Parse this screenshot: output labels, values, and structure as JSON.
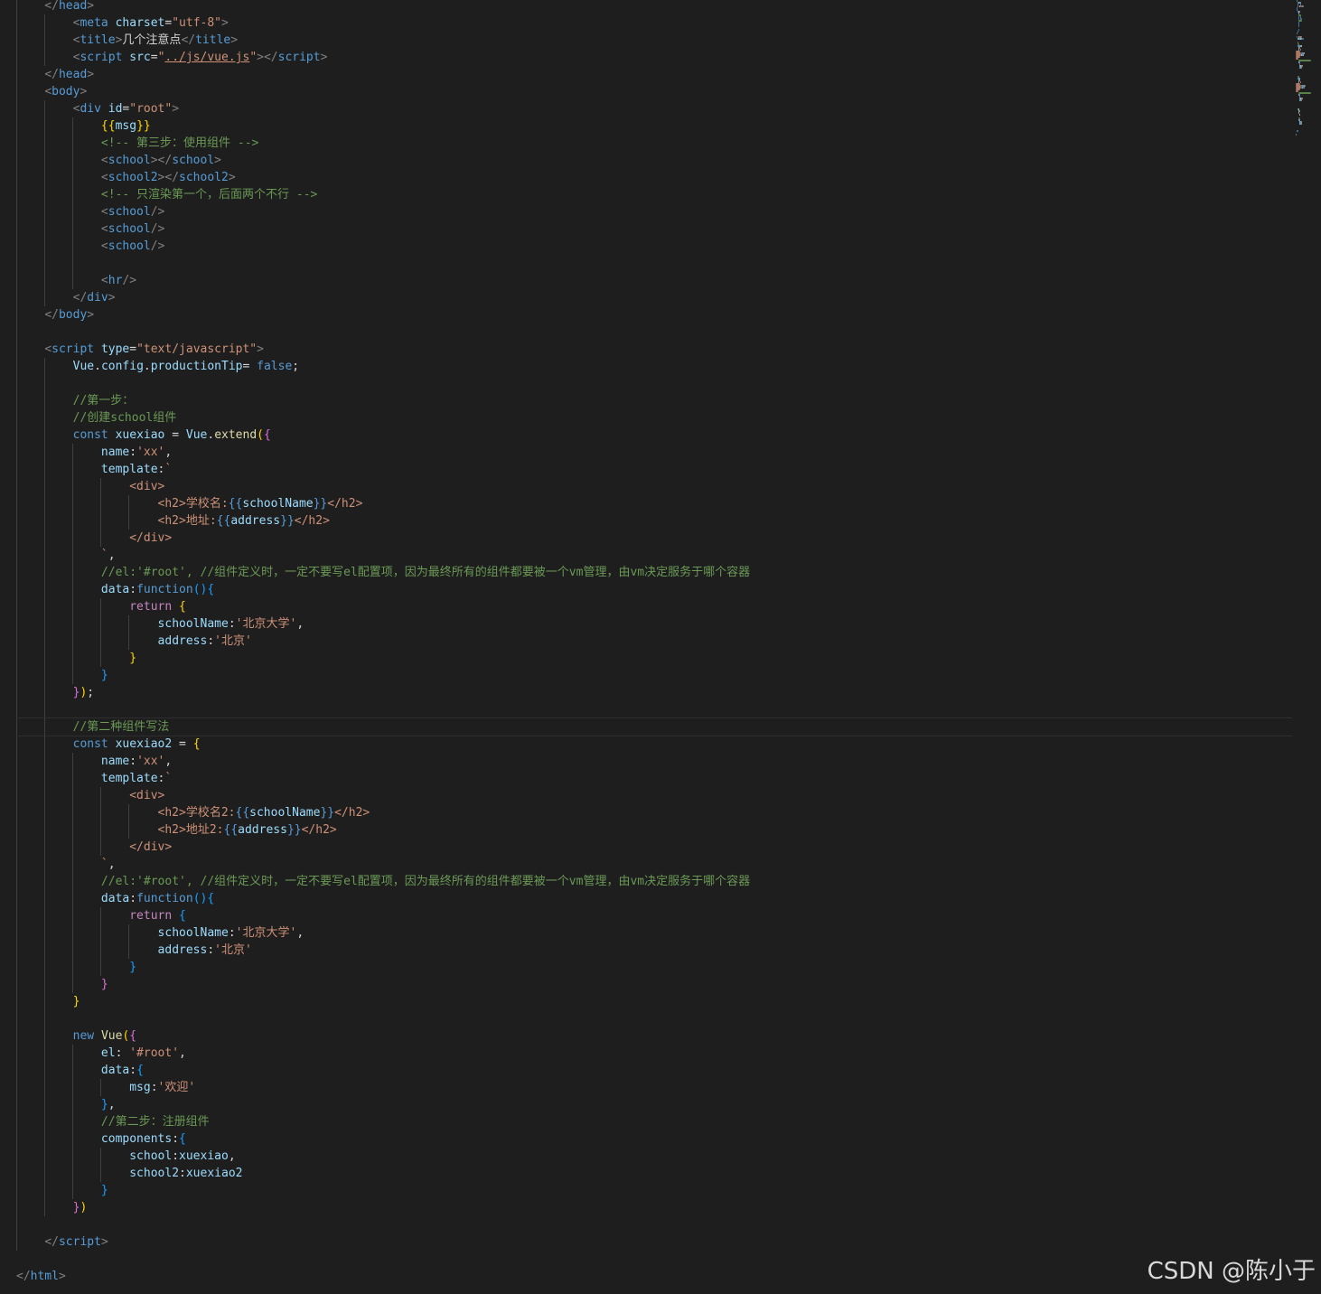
{
  "editor": {
    "lines": [
      [
        [
          "t-br",
          "    </"
        ],
        [
          "t-tag",
          "head"
        ],
        [
          "t-br",
          ">"
        ]
      ],
      [
        [
          "t-txt",
          "        "
        ],
        [
          "t-br",
          "<"
        ],
        [
          "t-tag",
          "meta"
        ],
        [
          "t-txt",
          " "
        ],
        [
          "t-attr",
          "charset"
        ],
        [
          "t-txt",
          "="
        ],
        [
          "t-str",
          "\"utf-8\""
        ],
        [
          "t-br",
          ">"
        ]
      ],
      [
        [
          "t-txt",
          "        "
        ],
        [
          "t-br",
          "<"
        ],
        [
          "t-tag",
          "title"
        ],
        [
          "t-br",
          ">"
        ],
        [
          "t-txt",
          "几个注意点"
        ],
        [
          "t-br",
          "</"
        ],
        [
          "t-tag",
          "title"
        ],
        [
          "t-br",
          ">"
        ]
      ],
      [
        [
          "t-txt",
          "        "
        ],
        [
          "t-br",
          "<"
        ],
        [
          "t-tag",
          "script"
        ],
        [
          "t-txt",
          " "
        ],
        [
          "t-attr",
          "src"
        ],
        [
          "t-txt",
          "="
        ],
        [
          "t-str",
          "\""
        ],
        [
          "t-link",
          "../js/vue.js"
        ],
        [
          "t-str",
          "\""
        ],
        [
          "t-br",
          "></"
        ],
        [
          "t-tag",
          "script"
        ],
        [
          "t-br",
          ">"
        ]
      ],
      [
        [
          "t-txt",
          "    "
        ],
        [
          "t-br",
          "</"
        ],
        [
          "t-tag",
          "head"
        ],
        [
          "t-br",
          ">"
        ]
      ],
      [
        [
          "t-txt",
          "    "
        ],
        [
          "t-br",
          "<"
        ],
        [
          "t-tag",
          "body"
        ],
        [
          "t-br",
          ">"
        ]
      ],
      [
        [
          "t-txt",
          "        "
        ],
        [
          "t-br",
          "<"
        ],
        [
          "t-tag",
          "div"
        ],
        [
          "t-txt",
          " "
        ],
        [
          "t-attr",
          "id"
        ],
        [
          "t-txt",
          "="
        ],
        [
          "t-str",
          "\"root\""
        ],
        [
          "t-br",
          ">"
        ]
      ],
      [
        [
          "t-txt",
          "            "
        ],
        [
          "t-p1",
          "{{"
        ],
        [
          "t-var",
          "msg"
        ],
        [
          "t-p1",
          "}}"
        ]
      ],
      [
        [
          "t-txt",
          "            "
        ],
        [
          "t-com",
          "<!-- 第三步：使用组件 -->"
        ]
      ],
      [
        [
          "t-txt",
          "            "
        ],
        [
          "t-br",
          "<"
        ],
        [
          "t-tag",
          "school"
        ],
        [
          "t-br",
          "></"
        ],
        [
          "t-tag",
          "school"
        ],
        [
          "t-br",
          ">"
        ]
      ],
      [
        [
          "t-txt",
          "            "
        ],
        [
          "t-br",
          "<"
        ],
        [
          "t-tag",
          "school2"
        ],
        [
          "t-br",
          "></"
        ],
        [
          "t-tag",
          "school2"
        ],
        [
          "t-br",
          ">"
        ]
      ],
      [
        [
          "t-txt",
          "            "
        ],
        [
          "t-com",
          "<!-- 只渲染第一个，后面两个不行 -->"
        ]
      ],
      [
        [
          "t-txt",
          "            "
        ],
        [
          "t-br",
          "<"
        ],
        [
          "t-tag",
          "school"
        ],
        [
          "t-br",
          "/>"
        ]
      ],
      [
        [
          "t-txt",
          "            "
        ],
        [
          "t-br",
          "<"
        ],
        [
          "t-tag",
          "school"
        ],
        [
          "t-br",
          "/>"
        ]
      ],
      [
        [
          "t-txt",
          "            "
        ],
        [
          "t-br",
          "<"
        ],
        [
          "t-tag",
          "school"
        ],
        [
          "t-br",
          "/>"
        ]
      ],
      [],
      [
        [
          "t-txt",
          "            "
        ],
        [
          "t-br",
          "<"
        ],
        [
          "t-tag",
          "hr"
        ],
        [
          "t-br",
          "/>"
        ]
      ],
      [
        [
          "t-txt",
          "        "
        ],
        [
          "t-br",
          "</"
        ],
        [
          "t-tag",
          "div"
        ],
        [
          "t-br",
          ">"
        ]
      ],
      [
        [
          "t-txt",
          "    "
        ],
        [
          "t-br",
          "</"
        ],
        [
          "t-tag",
          "body"
        ],
        [
          "t-br",
          ">"
        ]
      ],
      [],
      [
        [
          "t-txt",
          "    "
        ],
        [
          "t-br",
          "<"
        ],
        [
          "t-tag",
          "script"
        ],
        [
          "t-txt",
          " "
        ],
        [
          "t-attr",
          "type"
        ],
        [
          "t-txt",
          "="
        ],
        [
          "t-str",
          "\"text/javascript\""
        ],
        [
          "t-br",
          ">"
        ]
      ],
      [
        [
          "t-txt",
          "        "
        ],
        [
          "t-var",
          "Vue"
        ],
        [
          "t-txt",
          "."
        ],
        [
          "t-var",
          "config"
        ],
        [
          "t-txt",
          "."
        ],
        [
          "t-var",
          "productionTip"
        ],
        [
          "t-txt",
          "= "
        ],
        [
          "t-kw",
          "false"
        ],
        [
          "t-txt",
          ";"
        ]
      ],
      [],
      [
        [
          "t-txt",
          "        "
        ],
        [
          "t-com",
          "//第一步："
        ]
      ],
      [
        [
          "t-txt",
          "        "
        ],
        [
          "t-com",
          "//创建school组件"
        ]
      ],
      [
        [
          "t-txt",
          "        "
        ],
        [
          "t-kw",
          "const"
        ],
        [
          "t-txt",
          " "
        ],
        [
          "t-var",
          "xuexiao"
        ],
        [
          "t-txt",
          " = "
        ],
        [
          "t-var",
          "Vue"
        ],
        [
          "t-txt",
          "."
        ],
        [
          "t-fn",
          "extend"
        ],
        [
          "t-p1",
          "("
        ],
        [
          "t-p2",
          "{"
        ]
      ],
      [
        [
          "t-txt",
          "            "
        ],
        [
          "t-var",
          "name"
        ],
        [
          "t-txt",
          ":"
        ],
        [
          "t-str",
          "'xx'"
        ],
        [
          "t-txt",
          ","
        ]
      ],
      [
        [
          "t-txt",
          "            "
        ],
        [
          "t-var",
          "template"
        ],
        [
          "t-txt",
          ":"
        ],
        [
          "t-str",
          "`"
        ]
      ],
      [
        [
          "t-str",
          "                <div>"
        ]
      ],
      [
        [
          "t-str",
          "                    <h2>学校名:"
        ],
        [
          "t-kw",
          "{{"
        ],
        [
          "t-var",
          "schoolName"
        ],
        [
          "t-kw",
          "}}"
        ],
        [
          "t-str",
          "</h2>"
        ]
      ],
      [
        [
          "t-str",
          "                    <h2>地址:"
        ],
        [
          "t-kw",
          "{{"
        ],
        [
          "t-var",
          "address"
        ],
        [
          "t-kw",
          "}}"
        ],
        [
          "t-str",
          "</h2>"
        ]
      ],
      [
        [
          "t-str",
          "                </div>"
        ]
      ],
      [
        [
          "t-str",
          "            `"
        ],
        [
          "t-txt",
          ","
        ]
      ],
      [
        [
          "t-txt",
          "            "
        ],
        [
          "t-com",
          "//el:'#root', //组件定义时，一定不要写el配置项，因为最终所有的组件都要被一个vm管理，由vm决定服务于哪个容器"
        ]
      ],
      [
        [
          "t-txt",
          "            "
        ],
        [
          "t-var",
          "data"
        ],
        [
          "t-txt",
          ":"
        ],
        [
          "t-kw",
          "function"
        ],
        [
          "t-p3",
          "()"
        ],
        [
          "t-p3",
          "{"
        ]
      ],
      [
        [
          "t-txt",
          "                "
        ],
        [
          "t-ctl",
          "return"
        ],
        [
          "t-txt",
          " "
        ],
        [
          "t-p1",
          "{"
        ]
      ],
      [
        [
          "t-txt",
          "                    "
        ],
        [
          "t-var",
          "schoolName"
        ],
        [
          "t-txt",
          ":"
        ],
        [
          "t-str",
          "'北京大学'"
        ],
        [
          "t-txt",
          ","
        ]
      ],
      [
        [
          "t-txt",
          "                    "
        ],
        [
          "t-var",
          "address"
        ],
        [
          "t-txt",
          ":"
        ],
        [
          "t-str",
          "'北京'"
        ]
      ],
      [
        [
          "t-txt",
          "                "
        ],
        [
          "t-p1",
          "}"
        ]
      ],
      [
        [
          "t-txt",
          "            "
        ],
        [
          "t-p3",
          "}"
        ]
      ],
      [
        [
          "t-txt",
          "        "
        ],
        [
          "t-p2",
          "}"
        ],
        [
          "t-p1",
          ")"
        ],
        [
          "t-txt",
          ";"
        ]
      ],
      [],
      [
        [
          "t-txt",
          "        "
        ],
        [
          "t-com",
          "//第二种组件写法"
        ]
      ],
      [
        [
          "t-txt",
          "        "
        ],
        [
          "t-kw",
          "const"
        ],
        [
          "t-txt",
          " "
        ],
        [
          "t-var",
          "xuexiao2"
        ],
        [
          "t-txt",
          " = "
        ],
        [
          "t-p1",
          "{"
        ]
      ],
      [
        [
          "t-txt",
          "            "
        ],
        [
          "t-var",
          "name"
        ],
        [
          "t-txt",
          ":"
        ],
        [
          "t-str",
          "'xx'"
        ],
        [
          "t-txt",
          ","
        ]
      ],
      [
        [
          "t-txt",
          "            "
        ],
        [
          "t-var",
          "template"
        ],
        [
          "t-txt",
          ":"
        ],
        [
          "t-str",
          "`"
        ]
      ],
      [
        [
          "t-str",
          "                <div>"
        ]
      ],
      [
        [
          "t-str",
          "                    <h2>学校名2:"
        ],
        [
          "t-kw",
          "{{"
        ],
        [
          "t-var",
          "schoolName"
        ],
        [
          "t-kw",
          "}}"
        ],
        [
          "t-str",
          "</h2>"
        ]
      ],
      [
        [
          "t-str",
          "                    <h2>地址2:"
        ],
        [
          "t-kw",
          "{{"
        ],
        [
          "t-var",
          "address"
        ],
        [
          "t-kw",
          "}}"
        ],
        [
          "t-str",
          "</h2>"
        ]
      ],
      [
        [
          "t-str",
          "                </div>"
        ]
      ],
      [
        [
          "t-str",
          "            `"
        ],
        [
          "t-txt",
          ","
        ]
      ],
      [
        [
          "t-txt",
          "            "
        ],
        [
          "t-com",
          "//el:'#root', //组件定义时，一定不要写el配置项，因为最终所有的组件都要被一个vm管理，由vm决定服务于哪个容器"
        ]
      ],
      [
        [
          "t-txt",
          "            "
        ],
        [
          "t-var",
          "data"
        ],
        [
          "t-txt",
          ":"
        ],
        [
          "t-kw",
          "function"
        ],
        [
          "t-p3",
          "()"
        ],
        [
          "t-p3",
          "{"
        ]
      ],
      [
        [
          "t-txt",
          "                "
        ],
        [
          "t-ctl",
          "return"
        ],
        [
          "t-txt",
          " "
        ],
        [
          "t-p3",
          "{"
        ]
      ],
      [
        [
          "t-txt",
          "                    "
        ],
        [
          "t-var",
          "schoolName"
        ],
        [
          "t-txt",
          ":"
        ],
        [
          "t-str",
          "'北京大学'"
        ],
        [
          "t-txt",
          ","
        ]
      ],
      [
        [
          "t-txt",
          "                    "
        ],
        [
          "t-var",
          "address"
        ],
        [
          "t-txt",
          ":"
        ],
        [
          "t-str",
          "'北京'"
        ]
      ],
      [
        [
          "t-txt",
          "                "
        ],
        [
          "t-p3",
          "}"
        ]
      ],
      [
        [
          "t-txt",
          "            "
        ],
        [
          "t-p2",
          "}"
        ]
      ],
      [
        [
          "t-txt",
          "        "
        ],
        [
          "t-p1",
          "}"
        ]
      ],
      [],
      [
        [
          "t-txt",
          "        "
        ],
        [
          "t-kw",
          "new"
        ],
        [
          "t-txt",
          " "
        ],
        [
          "t-fn",
          "Vue"
        ],
        [
          "t-p1",
          "("
        ],
        [
          "t-p2",
          "{"
        ]
      ],
      [
        [
          "t-txt",
          "            "
        ],
        [
          "t-var",
          "el"
        ],
        [
          "t-txt",
          ": "
        ],
        [
          "t-str",
          "'#root'"
        ],
        [
          "t-txt",
          ","
        ]
      ],
      [
        [
          "t-txt",
          "            "
        ],
        [
          "t-var",
          "data"
        ],
        [
          "t-txt",
          ":"
        ],
        [
          "t-p3",
          "{"
        ]
      ],
      [
        [
          "t-txt",
          "                "
        ],
        [
          "t-var",
          "msg"
        ],
        [
          "t-txt",
          ":"
        ],
        [
          "t-str",
          "'欢迎'"
        ]
      ],
      [
        [
          "t-txt",
          "            "
        ],
        [
          "t-p3",
          "}"
        ],
        [
          "t-txt",
          ","
        ]
      ],
      [
        [
          "t-txt",
          "            "
        ],
        [
          "t-com",
          "//第二步：注册组件"
        ]
      ],
      [
        [
          "t-txt",
          "            "
        ],
        [
          "t-var",
          "components"
        ],
        [
          "t-txt",
          ":"
        ],
        [
          "t-p3",
          "{"
        ]
      ],
      [
        [
          "t-txt",
          "                "
        ],
        [
          "t-var",
          "school"
        ],
        [
          "t-txt",
          ":"
        ],
        [
          "t-var",
          "xuexiao"
        ],
        [
          "t-txt",
          ","
        ]
      ],
      [
        [
          "t-txt",
          "                "
        ],
        [
          "t-var",
          "school2"
        ],
        [
          "t-txt",
          ":"
        ],
        [
          "t-var",
          "xuexiao2"
        ]
      ],
      [
        [
          "t-txt",
          "            "
        ],
        [
          "t-p3",
          "}"
        ]
      ],
      [
        [
          "t-txt",
          "        "
        ],
        [
          "t-p2",
          "}"
        ],
        [
          "t-p1",
          ")"
        ]
      ],
      [],
      [
        [
          "t-txt",
          "    "
        ],
        [
          "t-br",
          "</"
        ],
        [
          "t-tag",
          "script"
        ],
        [
          "t-br",
          ">"
        ]
      ],
      [],
      [
        [
          "t-br",
          "</"
        ],
        [
          "t-tag",
          "html"
        ],
        [
          "t-br",
          ">"
        ]
      ]
    ],
    "current_line_index": 42
  },
  "watermark": {
    "text": "CSDN @陈小于"
  },
  "colors": {
    "background": "#1e1e1e",
    "keyword": "#569cd6",
    "string": "#ce9178",
    "comment": "#6a9955",
    "variable": "#9cdcfe",
    "function": "#dcdcaa"
  }
}
